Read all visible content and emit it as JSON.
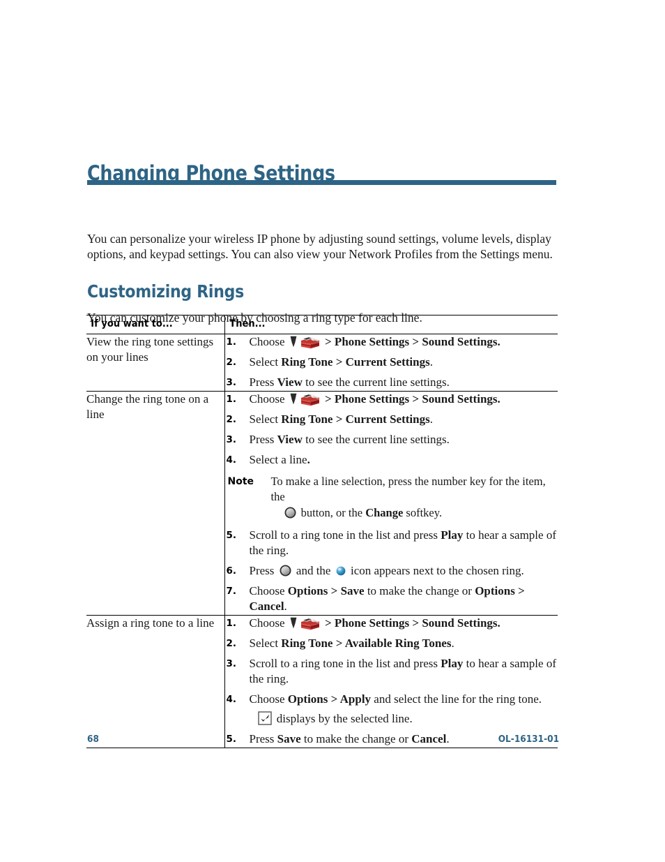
{
  "document": {
    "chapter_title": "Changing Phone Settings",
    "intro_paragraph": "You can personalize your wireless IP phone by adjusting sound settings, volume levels, display options, and keypad settings. You can also view your Network Profiles from the Settings menu.",
    "accent_color": "#2e6485"
  },
  "section": {
    "heading": "Customizing Rings",
    "intro": "You can customize your phone by choosing a ring type for each line."
  },
  "table": {
    "headers": {
      "col1": "If you want to...",
      "col2": "Then..."
    },
    "rows": [
      {
        "task": "View the ring tone settings on your lines",
        "steps": [
          {
            "num": "1.",
            "segments": [
              {
                "t": "text",
                "v": "Choose "
              },
              {
                "t": "icon",
                "v": "down-arrow-icon"
              },
              {
                "t": "icon",
                "v": "settings-toolbox-icon"
              },
              {
                "t": "bold",
                "v": " > Phone Settings > Sound Settings."
              }
            ]
          },
          {
            "num": "2.",
            "segments": [
              {
                "t": "text",
                "v": "Select "
              },
              {
                "t": "bold",
                "v": "Ring Tone > Current Settings"
              },
              {
                "t": "text",
                "v": "."
              }
            ]
          },
          {
            "num": "3.",
            "segments": [
              {
                "t": "text",
                "v": "Press "
              },
              {
                "t": "bold",
                "v": "View"
              },
              {
                "t": "text",
                "v": " to see the current line settings."
              }
            ]
          }
        ]
      },
      {
        "task": "Change the ring tone on a line",
        "steps": [
          {
            "num": "1.",
            "segments": [
              {
                "t": "text",
                "v": "Choose "
              },
              {
                "t": "icon",
                "v": "down-arrow-icon"
              },
              {
                "t": "icon",
                "v": "settings-toolbox-icon"
              },
              {
                "t": "bold",
                "v": " > Phone Settings > Sound Settings."
              }
            ]
          },
          {
            "num": "2.",
            "segments": [
              {
                "t": "text",
                "v": "Select "
              },
              {
                "t": "bold",
                "v": "Ring Tone > Current Settings"
              },
              {
                "t": "text",
                "v": "."
              }
            ]
          },
          {
            "num": "3.",
            "segments": [
              {
                "t": "text",
                "v": "Press "
              },
              {
                "t": "bold",
                "v": "View"
              },
              {
                "t": "text",
                "v": " to see the current line settings."
              }
            ]
          },
          {
            "num": "4.",
            "segments": [
              {
                "t": "text",
                "v": "Select a line"
              },
              {
                "t": "bold",
                "v": "."
              }
            ]
          }
        ],
        "note": {
          "label": "Note",
          "line1": "To make a line selection, press the number key for the item, the",
          "line2_pre": " button, or the ",
          "line2_bold": "Change",
          "line2_post": " softkey.",
          "icon": "select-button-icon"
        },
        "steps_after_note": [
          {
            "num": "5.",
            "segments": [
              {
                "t": "text",
                "v": "Scroll to a ring tone in the list and press "
              },
              {
                "t": "bold",
                "v": "Play"
              },
              {
                "t": "text",
                "v": " to hear a sample of the ring."
              }
            ]
          },
          {
            "num": "6.",
            "segments": [
              {
                "t": "text",
                "v": "Press "
              },
              {
                "t": "icon",
                "v": "select-button-icon"
              },
              {
                "t": "text",
                "v": " and the "
              },
              {
                "t": "icon",
                "v": "blue-sphere-icon"
              },
              {
                "t": "text",
                "v": " icon appears next to the chosen ring."
              }
            ]
          },
          {
            "num": "7.",
            "segments": [
              {
                "t": "text",
                "v": "Choose "
              },
              {
                "t": "bold",
                "v": "Options > Save"
              },
              {
                "t": "text",
                "v": " to make the change or "
              },
              {
                "t": "bold",
                "v": "Options > Cancel"
              },
              {
                "t": "text",
                "v": "."
              }
            ]
          }
        ]
      },
      {
        "task": "Assign a ring tone to a line",
        "steps": [
          {
            "num": "1.",
            "segments": [
              {
                "t": "text",
                "v": "Choose "
              },
              {
                "t": "icon",
                "v": "down-arrow-icon"
              },
              {
                "t": "icon",
                "v": "settings-toolbox-icon"
              },
              {
                "t": "bold",
                "v": " > Phone Settings > Sound Settings."
              }
            ]
          },
          {
            "num": "2.",
            "segments": [
              {
                "t": "text",
                "v": "Select "
              },
              {
                "t": "bold",
                "v": "Ring Tone > Available Ring Tones"
              },
              {
                "t": "text",
                "v": "."
              }
            ]
          },
          {
            "num": "3.",
            "segments": [
              {
                "t": "text",
                "v": "Scroll to a ring tone in the list and press "
              },
              {
                "t": "bold",
                "v": "Play"
              },
              {
                "t": "text",
                "v": " to hear a sample of the ring."
              }
            ]
          },
          {
            "num": "4.",
            "segments": [
              {
                "t": "text",
                "v": "Choose "
              },
              {
                "t": "bold",
                "v": "Options > Apply"
              },
              {
                "t": "text",
                "v": " and select the line for the ring tone."
              }
            ],
            "sub_line": {
              "icon": "checkmark-box-icon",
              "text": "displays by the selected line."
            }
          },
          {
            "num": "5.",
            "segments": [
              {
                "t": "text",
                "v": "Press "
              },
              {
                "t": "bold",
                "v": "Save"
              },
              {
                "t": "text",
                "v": " to make the change or "
              },
              {
                "t": "bold",
                "v": "Cancel"
              },
              {
                "t": "text",
                "v": "."
              }
            ]
          }
        ]
      }
    ]
  },
  "footer": {
    "page_number": "68",
    "doc_id": "OL-16131-01"
  },
  "icon_glyphs": {
    "down-arrow-icon": "down-arrow-icon",
    "settings-toolbox-icon": "settings-toolbox-icon",
    "select-button-icon": "select-button-icon",
    "blue-sphere-icon": "blue-sphere-icon",
    "checkmark-box-icon": "checkmark-box-icon"
  }
}
